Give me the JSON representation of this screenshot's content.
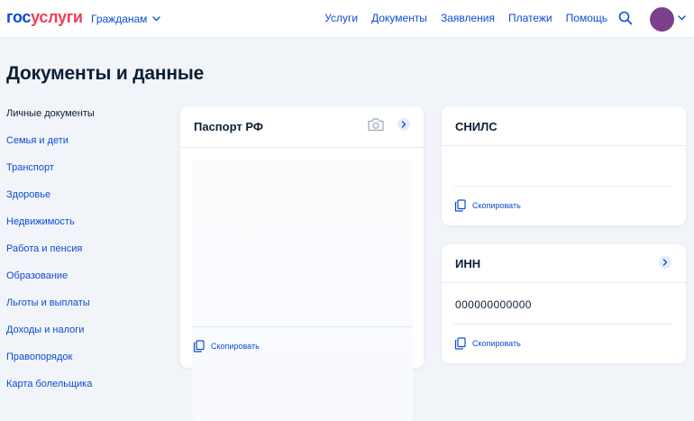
{
  "header": {
    "logo_part1": "гос",
    "logo_part2": "услуги",
    "audience_label": "Гражданам",
    "nav": [
      "Услуги",
      "Документы",
      "Заявления",
      "Платежи",
      "Помощь"
    ]
  },
  "page": {
    "title": "Документы и данные"
  },
  "sidebar": {
    "items": [
      "Личные документы",
      "Семья и дети",
      "Транспорт",
      "Здоровье",
      "Недвижимость",
      "Работа и пенсия",
      "Образование",
      "Льготы и выплаты",
      "Доходы и налоги",
      "Правопорядок",
      "Карта болельщика"
    ]
  },
  "cards": {
    "passport": {
      "title": "Паспорт РФ",
      "copy_label": "Скопировать"
    },
    "snils": {
      "title": "СНИЛС",
      "copy_label": "Скопировать"
    },
    "inn": {
      "title": "ИНН",
      "value": "000000000000",
      "copy_label": "Скопировать"
    }
  },
  "icons": {
    "search": "search-icon",
    "camera": "camera-icon",
    "arrow": "chevron-right-icon",
    "copy": "copy-icon"
  },
  "colors": {
    "accent": "#0d4cd3",
    "logo_red": "#ee3f58",
    "avatar": "#7b3f8c",
    "background": "#f1f4f9",
    "text": "#0b1f33"
  }
}
